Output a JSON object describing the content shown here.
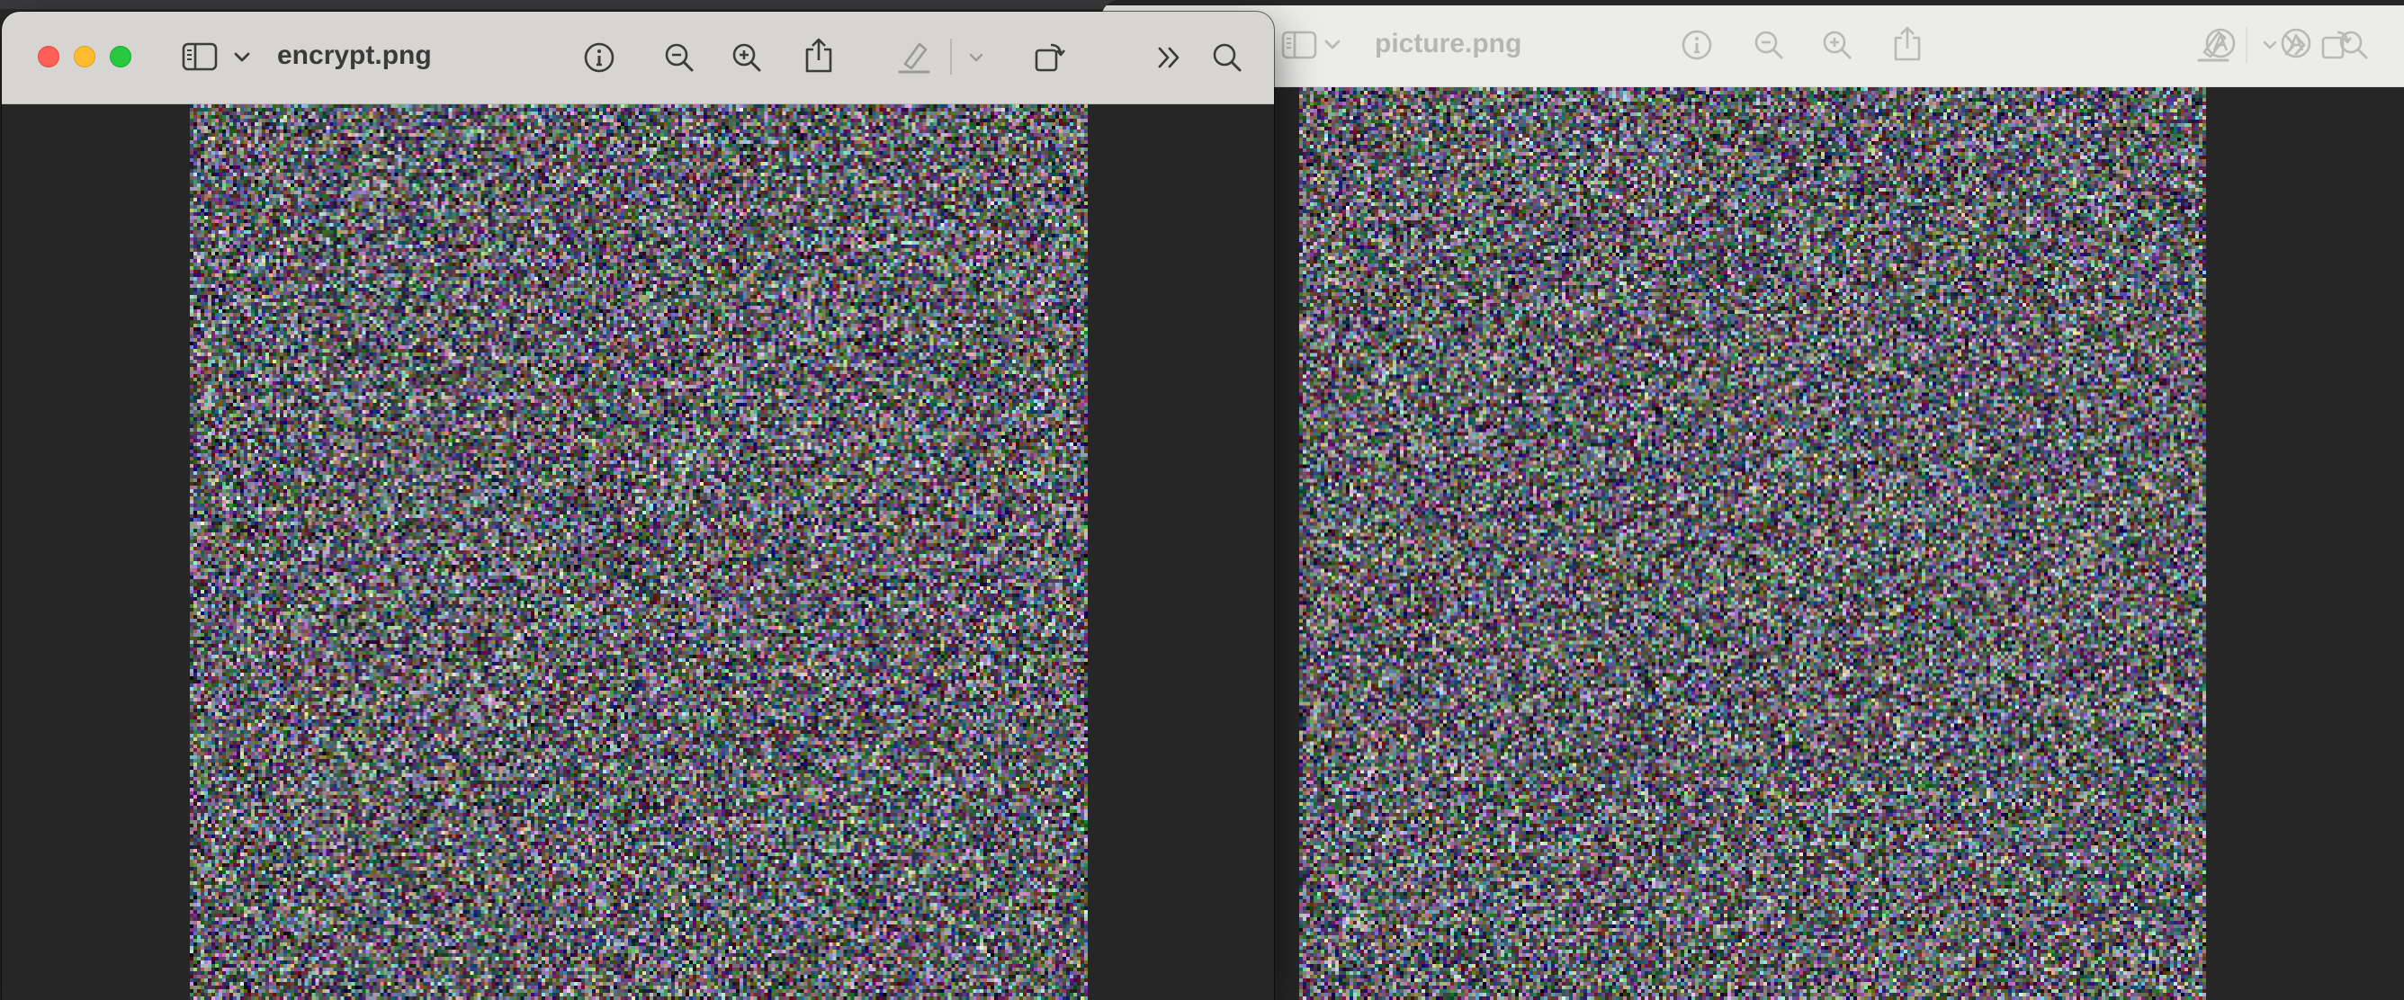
{
  "windows": {
    "front": {
      "title": "encrypt.png",
      "toolbar_icons": [
        "sidebar-toggle-icon",
        "chevron-down-icon",
        "info-icon",
        "zoom-out-icon",
        "zoom-in-icon",
        "share-icon",
        "highlight-pen-icon",
        "chevron-down-icon",
        "rotate-icon",
        "more-chevrons-icon",
        "search-icon"
      ]
    },
    "back": {
      "title": "picture.png",
      "toolbar_icons": [
        "sidebar-toggle-icon",
        "chevron-down-icon",
        "info-icon",
        "zoom-out-icon",
        "zoom-in-icon",
        "share-icon",
        "highlight-pen-icon",
        "chevron-down-icon",
        "rotate-icon",
        "markup-icon",
        "more-chevrons-icon",
        "search-icon"
      ]
    }
  },
  "colors": {
    "front_titlebar": "#d6d5d2",
    "back_titlebar": "#ececea",
    "window_background": "#262626",
    "traffic_close": "#fe5f57",
    "traffic_minimize": "#febc2e",
    "traffic_zoom": "#28c840"
  }
}
